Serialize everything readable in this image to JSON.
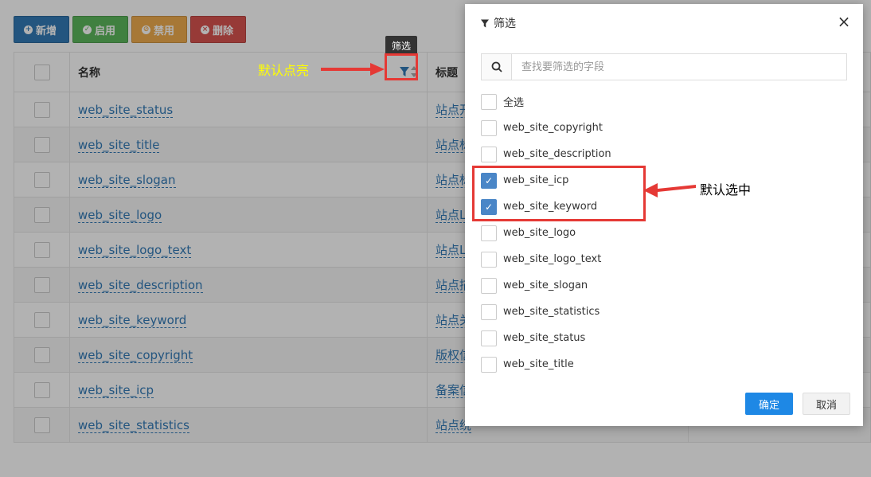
{
  "toolbar": {
    "add_label": "新增",
    "enable_label": "启用",
    "disable_label": "禁用",
    "delete_label": "删除"
  },
  "table": {
    "headers": {
      "name": "名称",
      "title": "标题"
    },
    "rows": [
      {
        "name": "web_site_status",
        "title": "站点开"
      },
      {
        "name": "web_site_title",
        "title": "站点标"
      },
      {
        "name": "web_site_slogan",
        "title": "站点标"
      },
      {
        "name": "web_site_logo",
        "title": "站点L"
      },
      {
        "name": "web_site_logo_text",
        "title": "站点L"
      },
      {
        "name": "web_site_description",
        "title": "站点描"
      },
      {
        "name": "web_site_keyword",
        "title": "站点关"
      },
      {
        "name": "web_site_copyright",
        "title": "版权信"
      },
      {
        "name": "web_site_icp",
        "title": "备案信"
      },
      {
        "name": "web_site_statistics",
        "title": "站点统"
      }
    ]
  },
  "tooltip": "筛选",
  "annotations": {
    "highlight": "默认点亮",
    "selected": "默认选中"
  },
  "dialog": {
    "title": "筛选",
    "search_placeholder": "查找要筛选的字段",
    "options": [
      {
        "label": "全选",
        "checked": false
      },
      {
        "label": "web_site_copyright",
        "checked": false
      },
      {
        "label": "web_site_description",
        "checked": false
      },
      {
        "label": "web_site_icp",
        "checked": true
      },
      {
        "label": "web_site_keyword",
        "checked": true
      },
      {
        "label": "web_site_logo",
        "checked": false
      },
      {
        "label": "web_site_logo_text",
        "checked": false
      },
      {
        "label": "web_site_slogan",
        "checked": false
      },
      {
        "label": "web_site_statistics",
        "checked": false
      },
      {
        "label": "web_site_status",
        "checked": false
      },
      {
        "label": "web_site_title",
        "checked": false
      }
    ],
    "ok_label": "确定",
    "cancel_label": "取消"
  },
  "colors": {
    "primary": "#337ab7",
    "success": "#5cb85c",
    "warning": "#f0ad4e",
    "danger": "#d9534f",
    "annotation_red": "#e53935",
    "annotation_yellow": "#ffff00",
    "checkbox_checked": "#4a86c7",
    "ok_button": "#1e88e5"
  }
}
